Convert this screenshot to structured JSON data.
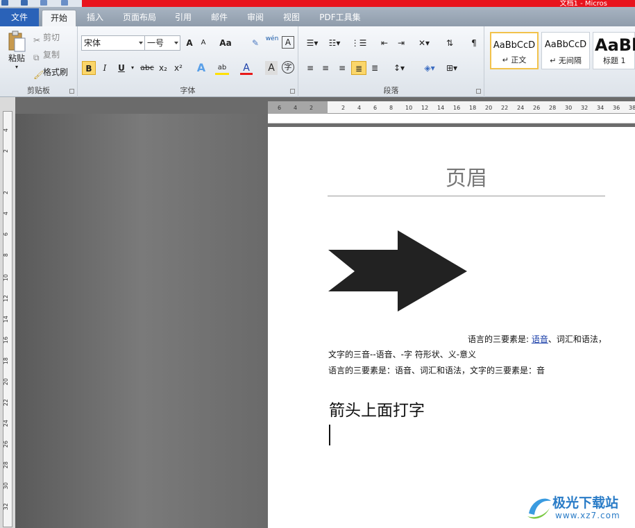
{
  "titlebar": {
    "text": "文档1 - Micros"
  },
  "tabs": [
    "文件",
    "开始",
    "插入",
    "页面布局",
    "引用",
    "邮件",
    "审阅",
    "视图",
    "PDF工具集"
  ],
  "clipboard": {
    "paste": "粘贴",
    "cut": "剪切",
    "copy": "复制",
    "painter": "格式刷",
    "label": "剪贴板"
  },
  "font": {
    "name": "宋体",
    "size": "一号",
    "label": "字体",
    "aa": "Aa",
    "wen": "wén",
    "bold": "B",
    "italic": "I",
    "underline": "U",
    "strike": "abc",
    "sub": "x₂",
    "sup": "x²",
    "color_a": "A",
    "char": "字",
    "effect": "A",
    "border": "A",
    "grow": "A",
    "shrink": "A"
  },
  "paragraph": {
    "label": "段落"
  },
  "styles": [
    {
      "preview": "AaBbCcD",
      "name": "↵ 正文"
    },
    {
      "preview": "AaBbCcD",
      "name": "↵ 无间隔"
    },
    {
      "preview": "AaBb",
      "name": "标题 1"
    }
  ],
  "ruler_h": [
    "6",
    "4",
    "2",
    "",
    "2",
    "4",
    "6",
    "8",
    "10",
    "12",
    "14",
    "16",
    "18",
    "20",
    "22",
    "24",
    "26",
    "28",
    "30",
    "32",
    "34",
    "36",
    "38"
  ],
  "ruler_v": [
    "4",
    "2",
    "",
    "2",
    "4",
    "6",
    "8",
    "10",
    "12",
    "14",
    "16",
    "18",
    "20",
    "22",
    "24",
    "26",
    "28",
    "30",
    "32"
  ],
  "doc": {
    "header": "页眉",
    "line1_a": "语言的三要素是: ",
    "line1_link": "语音",
    "line1_b": "、词汇和语法，",
    "line2": "文字的三音--语音、-字 符形状、义-意义",
    "line3": "语言的三要素是：语音、词汇和语法，文字的三要素是：音",
    "heading": "箭头上面打字"
  },
  "watermark": {
    "name": "极光下载站",
    "url": "www.xz7.com"
  },
  "colors": {
    "red_band": "#e8131c",
    "file_tab": "#2a62b8",
    "arrow": "#222222"
  }
}
